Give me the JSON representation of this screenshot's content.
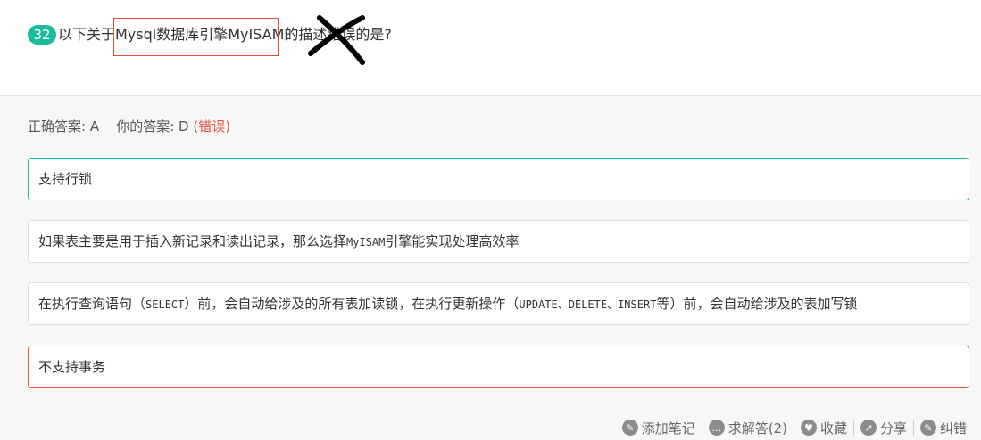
{
  "question": {
    "number": "32",
    "text": "以下关于Mysql数据库引擎MyISAM的描述错误的是?"
  },
  "answer": {
    "correct_label": "正确答案:",
    "correct_value": "A",
    "yours_label": "你的答案:",
    "yours_value": "D",
    "status": "(错误)"
  },
  "options": [
    {
      "pre": "支持行锁"
    },
    {
      "pre": "如果表主要是用于插入新记录和读出记录，那么选择",
      "code1": "MyISAM",
      "post": "引擎能实现处理高效率"
    },
    {
      "pre": "在执行查询语句（",
      "code1": "SELECT",
      "mid": "）前，会自动给涉及的所有表加读锁，在执行更新操作（",
      "code2": "UPDATE、DELETE、INSERT",
      "post": "等）前，会自动给涉及的表加写锁"
    },
    {
      "pre": "不支持事务"
    }
  ],
  "actions": [
    {
      "label": "添加笔记",
      "icon": "note-icon"
    },
    {
      "label": "求解答(2)",
      "icon": "chat-icon"
    },
    {
      "label": "收藏",
      "icon": "heart-icon"
    },
    {
      "label": "分享",
      "icon": "share-icon"
    },
    {
      "label": "纠错",
      "icon": "edit-icon"
    }
  ],
  "colors": {
    "accent": "#1abc9c",
    "error": "#e9573f",
    "highlight": "#e74c3c"
  }
}
